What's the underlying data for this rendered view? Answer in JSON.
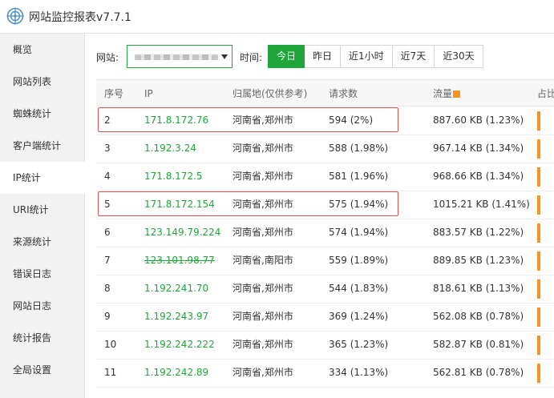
{
  "app": {
    "title": "网站监控报表v7.7.1",
    "logo": "target-logo-icon"
  },
  "sidebar": {
    "items": [
      {
        "label": "概览",
        "active": false
      },
      {
        "label": "网站列表",
        "active": false
      },
      {
        "label": "蜘蛛统计",
        "active": false
      },
      {
        "label": "客户端统计",
        "active": false
      },
      {
        "label": "IP统计",
        "active": true
      },
      {
        "label": "URI统计",
        "active": false
      },
      {
        "label": "来源统计",
        "active": false
      },
      {
        "label": "错误日志",
        "active": false
      },
      {
        "label": "网站日志",
        "active": false
      },
      {
        "label": "统计报告",
        "active": false
      },
      {
        "label": "全局设置",
        "active": false
      }
    ]
  },
  "filters": {
    "site_label": "网站:",
    "time_label": "时间:",
    "time_options": [
      {
        "label": "今日",
        "active": true
      },
      {
        "label": "昨日",
        "active": false
      },
      {
        "label": "近1小时",
        "active": false
      },
      {
        "label": "近7天",
        "active": false
      },
      {
        "label": "近30天",
        "active": false
      }
    ]
  },
  "table": {
    "headers": {
      "index": "序号",
      "ip": "IP",
      "location": "归属地(仅供参考)",
      "requests": "请求数",
      "traffic": "流量",
      "share": "占比"
    },
    "rows": [
      {
        "index": "2",
        "ip": "171.8.172.76",
        "location": "河南省,郑州市",
        "requests": "594 (2%)",
        "traffic": "887.60 KB (1.23%)",
        "highlighted": true
      },
      {
        "index": "3",
        "ip": "1.192.3.24",
        "location": "河南省,郑州市",
        "requests": "588 (1.98%)",
        "traffic": "967.14 KB (1.34%)"
      },
      {
        "index": "4",
        "ip": "171.8.172.5",
        "location": "河南省,郑州市",
        "requests": "581 (1.96%)",
        "traffic": "968.66 KB (1.34%)"
      },
      {
        "index": "5",
        "ip": "171.8.172.154",
        "location": "河南省,郑州市",
        "requests": "575 (1.94%)",
        "traffic": "1015.21 KB (1.41%)",
        "highlighted": true
      },
      {
        "index": "6",
        "ip": "123.149.79.224",
        "location": "河南省,郑州市",
        "requests": "574 (1.94%)",
        "traffic": "883.57 KB (1.22%)"
      },
      {
        "index": "7",
        "ip": "123.101.98.77",
        "location": "河南省,南阳市",
        "requests": "559 (1.89%)",
        "traffic": "889.85 KB (1.23%)",
        "strikethrough": true
      },
      {
        "index": "8",
        "ip": "1.192.241.70",
        "location": "河南省,郑州市",
        "requests": "544 (1.83%)",
        "traffic": "818.61 KB (1.13%)"
      },
      {
        "index": "9",
        "ip": "1.192.243.97",
        "location": "河南省,郑州市",
        "requests": "369 (1.24%)",
        "traffic": "562.08 KB (0.78%)"
      },
      {
        "index": "10",
        "ip": "1.192.242.222",
        "location": "河南省,郑州市",
        "requests": "365 (1.23%)",
        "traffic": "582.87 KB (0.81%)"
      },
      {
        "index": "11",
        "ip": "1.192.242.89",
        "location": "河南省,郑州市",
        "requests": "334 (1.13%)",
        "traffic": "562.81 KB (0.78%)"
      }
    ]
  },
  "colors": {
    "accent": "#20a53a",
    "bar": "#f7941d",
    "highlight": "#d9534f"
  }
}
